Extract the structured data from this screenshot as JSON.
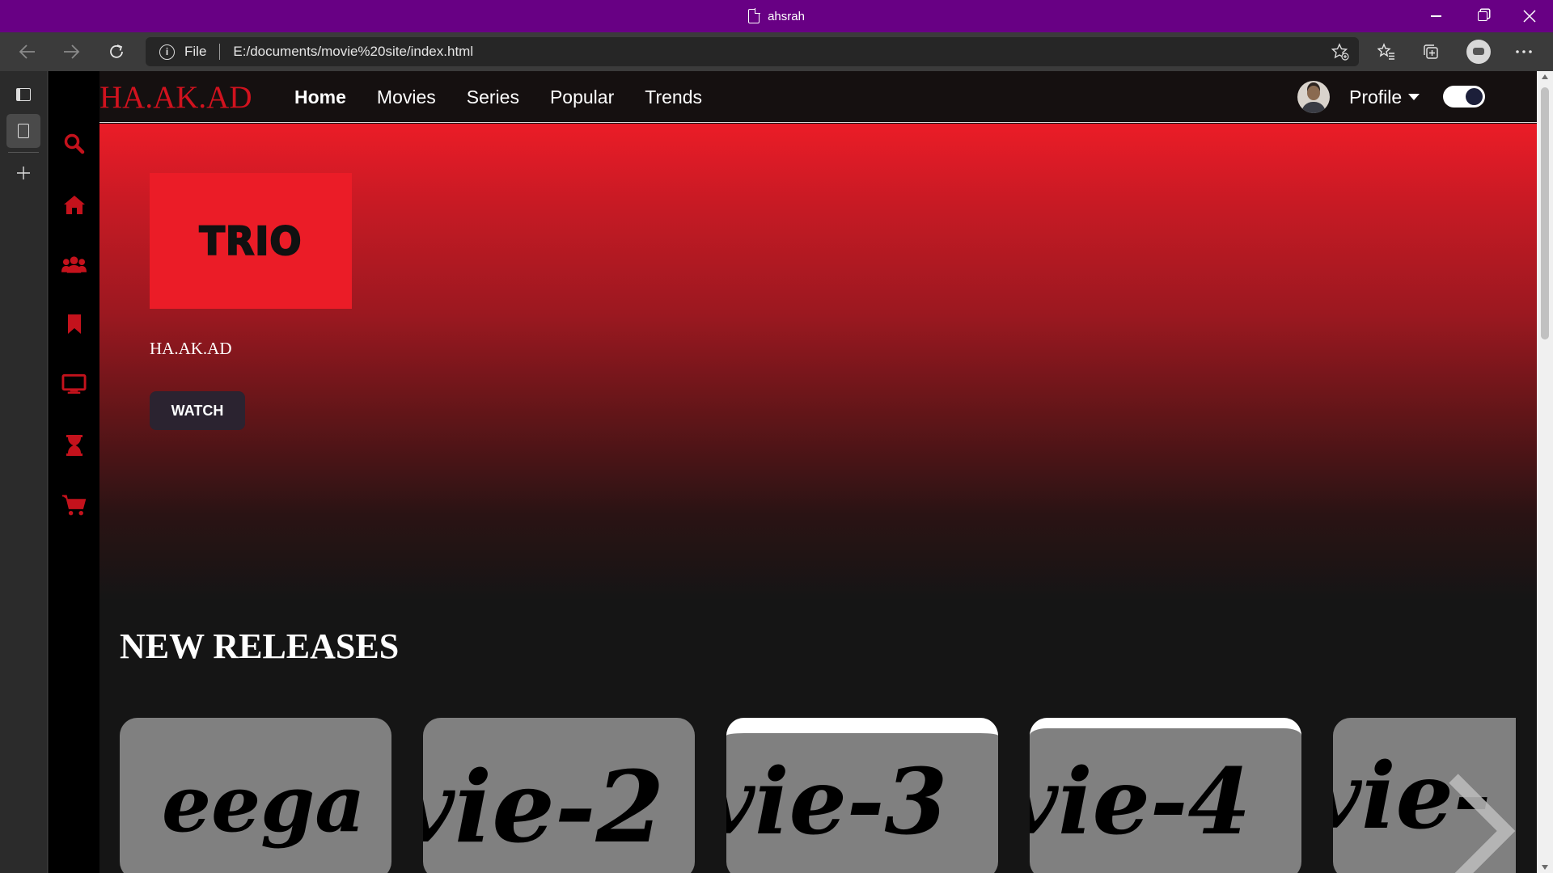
{
  "window": {
    "title": "ahsrah"
  },
  "browser": {
    "file_label": "File",
    "url": "E:/documents/movie%20site/index.html"
  },
  "site": {
    "logo": "HA.AK.AD",
    "nav": [
      "Home",
      "Movies",
      "Series",
      "Popular",
      "Trends"
    ],
    "active_nav": "Home",
    "profile_label": "Profile",
    "sidebar_icons": [
      "search-icon",
      "home-icon",
      "users-icon",
      "bookmark-icon",
      "tv-icon",
      "hourglass-icon",
      "cart-icon"
    ],
    "accent_color": "#eb1c27"
  },
  "hero": {
    "poster_text": "TRIO",
    "description": "HA.AK.AD",
    "watch_label": "WATCH"
  },
  "new_releases": {
    "title": "NEW RELEASES",
    "cards": [
      "eega",
      "vie-2",
      "vie-3",
      "vie-4",
      "vie-"
    ]
  }
}
